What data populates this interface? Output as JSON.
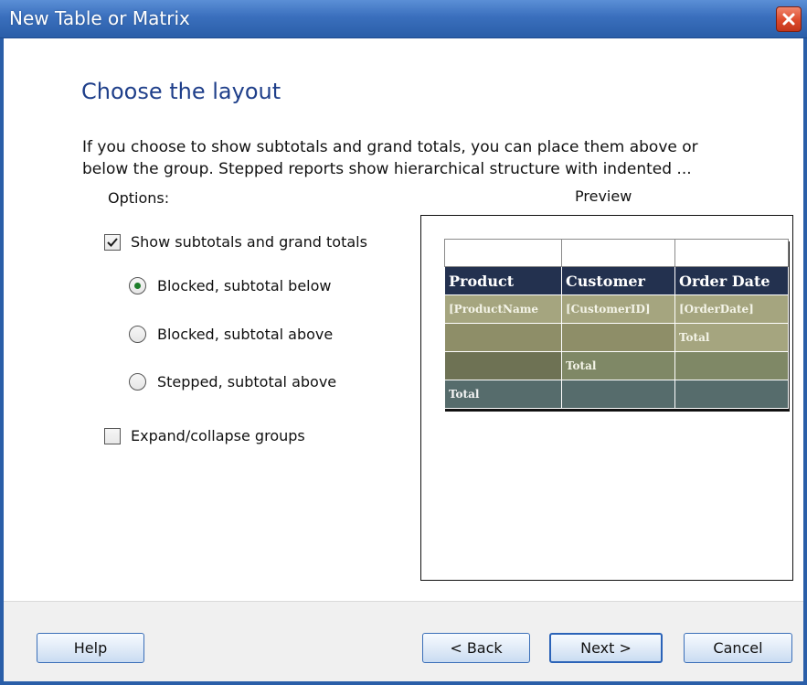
{
  "window": {
    "title": "New Table or Matrix",
    "close_icon": "close-icon"
  },
  "page": {
    "heading": "Choose the layout",
    "description_line1": "If you choose to show subtotals and grand totals, you can place them above or",
    "description_line2": "below the group. Stepped reports show hierarchical structure with indented ...",
    "options_label": "Options:",
    "preview_label": "Preview"
  },
  "options": {
    "show_totals": {
      "label": "Show subtotals and grand totals",
      "checked": true
    },
    "radios": [
      {
        "label": "Blocked, subtotal below",
        "selected": true
      },
      {
        "label": "Blocked, subtotal above",
        "selected": false
      },
      {
        "label": "Stepped, subtotal above",
        "selected": false
      }
    ],
    "expand_collapse": {
      "label": "Expand/collapse groups",
      "checked": false
    }
  },
  "preview": {
    "headers": [
      "Product",
      "Customer",
      "Order Date"
    ],
    "row1": [
      "[ProductName",
      "[CustomerID]",
      "[OrderDate]"
    ],
    "row2": [
      "",
      "",
      "Total"
    ],
    "row3": [
      "",
      "Total",
      ""
    ],
    "row4": [
      "Total",
      "",
      ""
    ]
  },
  "buttons": {
    "help": "Help",
    "back": "< Back",
    "next": "Next >",
    "cancel": "Cancel"
  },
  "colors": {
    "title_bar": "#2a5ea8",
    "heading_text": "#1f3f8a",
    "preview_header": "#23314f",
    "preview_olive": "#a5a57f",
    "preview_total": "#566c6c"
  }
}
